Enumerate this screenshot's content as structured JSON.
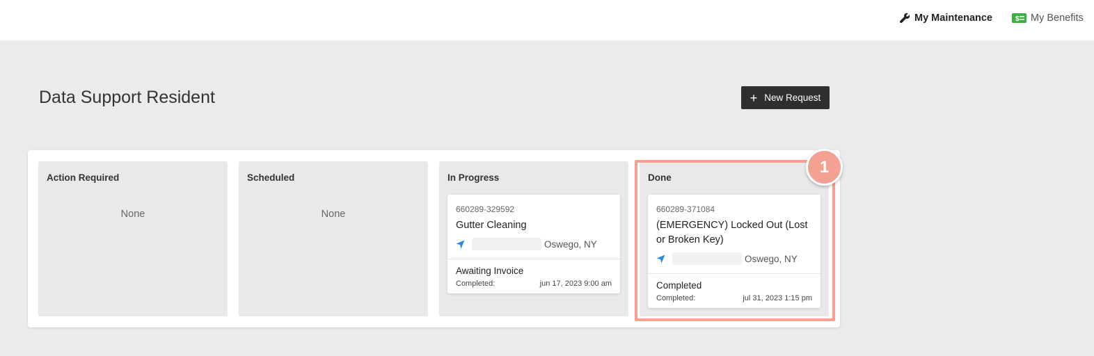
{
  "nav": {
    "maintenance_label": "My Maintenance",
    "benefits_label": "My Benefits",
    "maintenance_icon": "wrench-icon",
    "benefits_icon": "dollar-bill-icon",
    "benefits_icon_color": "#3cb043"
  },
  "page": {
    "title": "Data Support Resident",
    "new_request_label": "New Request"
  },
  "columns": [
    {
      "title": "Action Required",
      "empty_text": "None"
    },
    {
      "title": "Scheduled",
      "empty_text": "None"
    },
    {
      "title": "In Progress",
      "card": {
        "id": "660289-329592",
        "title": "Gutter Cleaning",
        "location": "Oswego, NY",
        "status": "Awaiting Invoice",
        "completed_label": "Completed:",
        "completed_date": "jun 17, 2023 9:00 am"
      }
    },
    {
      "title": "Done",
      "card": {
        "id": "660289-371084",
        "title": "(EMERGENCY) Locked Out (Lost or Broken Key)",
        "location": "Oswego, NY",
        "status": "Completed",
        "completed_label": "Completed:",
        "completed_date": "jul 31, 2023 1:15 pm"
      }
    }
  ],
  "annotation": {
    "step_number": "1",
    "color": "#f4a193"
  },
  "colors": {
    "location_icon": "#2a8be0",
    "button_bg": "#2f2f2f"
  }
}
